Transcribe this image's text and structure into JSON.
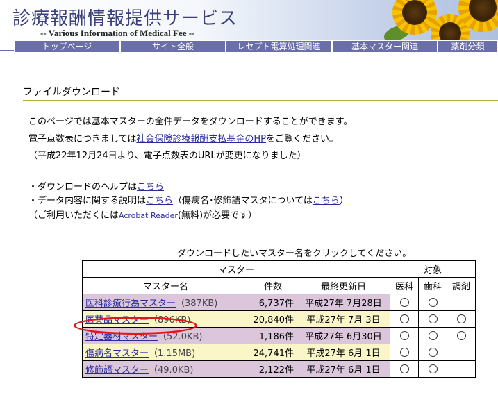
{
  "header": {
    "title": "診療報酬情報提供サービス",
    "subtitle": "-- Various Information of Medical Fee --"
  },
  "nav": [
    {
      "label": "トップページ"
    },
    {
      "label": "サイト全般"
    },
    {
      "label": "レセプト電算処理関連"
    },
    {
      "label": "基本マスター関連"
    },
    {
      "label": "薬剤分類"
    }
  ],
  "section": {
    "title": "ファイルダウンロード"
  },
  "intro": {
    "line1": "このページでは基本マスターの全件データをダウンロードすることができます。",
    "line2_pre": "電子点数表につきましては",
    "line2_link": "社会保険診療報酬支払基金のHP",
    "line2_post": "をご覧ください。",
    "line3": "（平成22年12月24日より、電子点数表のURLが変更になりました）"
  },
  "help": {
    "l1_pre": "・ダウンロードのヘルプは",
    "l1_link": "こちら",
    "l2_pre": "・データ内容に関する説明は",
    "l2_link1": "こちら",
    "l2_mid": "（傷病名･修飾語マスタについては",
    "l2_link2": "こちら",
    "l2_post": "）",
    "l3_pre": "（ご利用いただくには",
    "l3_link": "Acrobat Reader",
    "l3_post": "(無料)が必要です）"
  },
  "table": {
    "caption": "ダウンロードしたいマスター名をクリックしてください。",
    "group_master": "マスター",
    "group_target": "対象",
    "col_name": "マスター名",
    "col_count": "件数",
    "col_date": "最終更新日",
    "col_ika": "医科",
    "col_shika": "歯科",
    "col_chozai": "調剤",
    "rows": [
      {
        "name": "医科診療行為マスター",
        "size": "（387KB)",
        "count": "6,737件",
        "date": "平成27年 7月28日",
        "ika": true,
        "shika": true,
        "chozai": false
      },
      {
        "name": "医薬品マスター",
        "size": "（896KB)",
        "count": "20,840件",
        "date": "平成27年 7月 3日",
        "ika": true,
        "shika": true,
        "chozai": true
      },
      {
        "name": "特定器材マスター",
        "size": "（52.0KB)",
        "count": "1,186件",
        "date": "平成27年 6月30日",
        "ika": true,
        "shika": true,
        "chozai": true
      },
      {
        "name": "傷病名マスター",
        "size": "（1.15MB)",
        "count": "24,741件",
        "date": "平成27年 6月 1日",
        "ika": true,
        "shika": true,
        "chozai": false
      },
      {
        "name": "修飾語マスター",
        "size": "（49.0KB)",
        "count": "2,122件",
        "date": "平成27年 6月 1日",
        "ika": true,
        "shika": true,
        "chozai": false
      }
    ]
  },
  "colors": {
    "nav_bg": "#6b6fa8",
    "link": "#2a2a9c",
    "row_purple": "#dcc6dc",
    "row_yellow": "#fbf6c8",
    "highlight": "#e3161a"
  }
}
